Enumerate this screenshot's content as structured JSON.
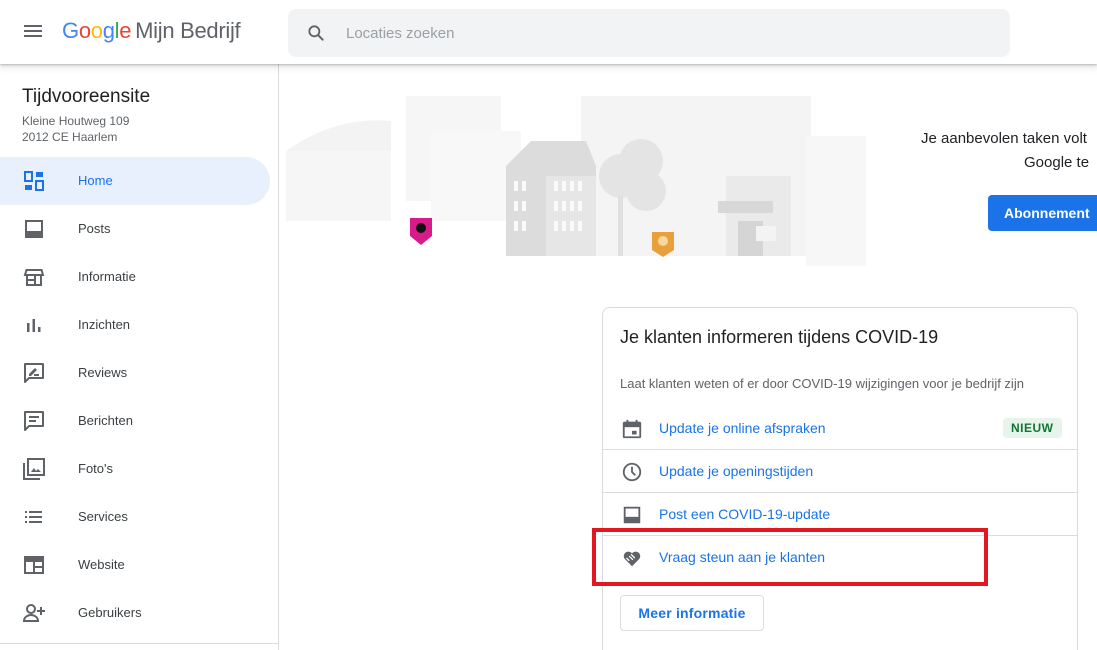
{
  "header": {
    "logo_letters": [
      "G",
      "o",
      "o",
      "g",
      "l",
      "e"
    ],
    "product": "Mijn Bedrijf",
    "search_placeholder": "Locaties zoeken"
  },
  "business": {
    "name": "Tijdvooreensite",
    "address_line1": "Kleine Houtweg 109",
    "address_line2": "2012 CE Haarlem"
  },
  "sidebar": {
    "items": [
      {
        "label": "Home",
        "icon": "dashboard-icon",
        "active": true
      },
      {
        "label": "Posts",
        "icon": "post-icon"
      },
      {
        "label": "Informatie",
        "icon": "storefront-icon"
      },
      {
        "label": "Inzichten",
        "icon": "insights-icon"
      },
      {
        "label": "Reviews",
        "icon": "reviews-icon"
      },
      {
        "label": "Berichten",
        "icon": "messages-icon"
      },
      {
        "label": "Foto's",
        "icon": "photos-icon"
      },
      {
        "label": "Services",
        "icon": "list-icon"
      },
      {
        "label": "Website",
        "icon": "website-icon"
      },
      {
        "label": "Gebruikers",
        "icon": "add-user-icon"
      }
    ]
  },
  "promo": {
    "line1": "Je aanbevolen taken volt",
    "line2": "Google te",
    "button": "Abonnement"
  },
  "covid_card": {
    "title": "Je klanten informeren tijdens COVID-19",
    "subtitle": "Laat klanten weten of er door COVID-19 wijzigingen voor je bedrijf zijn",
    "rows": [
      {
        "label": "Update je online afspraken",
        "icon": "calendar-icon",
        "badge": "NIEUW"
      },
      {
        "label": "Update je openingstijden",
        "icon": "clock-icon"
      },
      {
        "label": "Post een COVID-19-update",
        "icon": "post-icon"
      },
      {
        "label": "Vraag steun aan je klanten",
        "icon": "handshake-heart-icon"
      }
    ],
    "more_button": "Meer informatie"
  },
  "colors": {
    "accent": "#1a73e8",
    "active_bg": "#e8f0fe",
    "badge_bg": "#e6f4ea",
    "badge_text": "#137333",
    "highlight": "#e3171f"
  }
}
